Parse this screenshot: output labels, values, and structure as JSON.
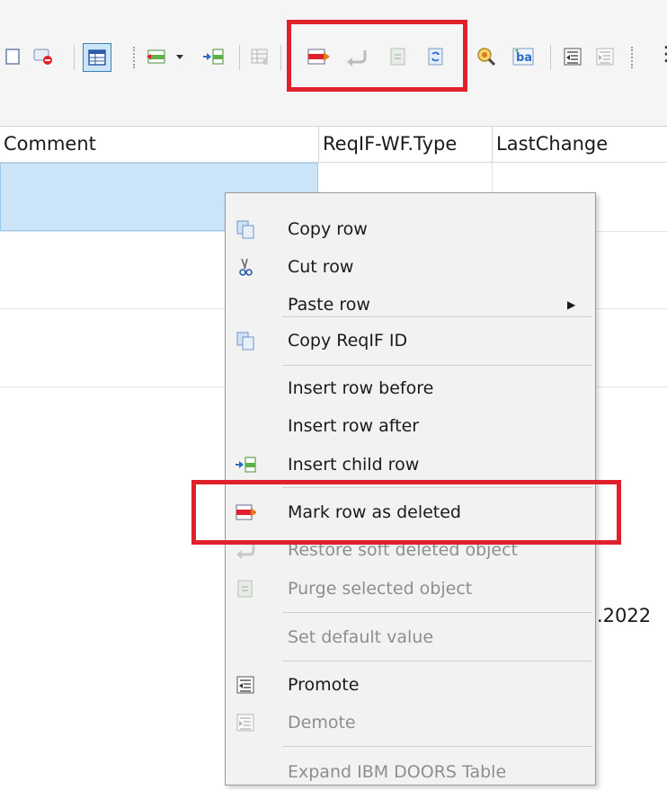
{
  "toolbar": {
    "icons": [
      "frame-icon",
      "comment-delete-icon",
      "table-view-icon",
      "insert-row-icon",
      "dropdown-arrow-icon",
      "insert-child-icon",
      "table-grid-icon",
      "mark-deleted-icon",
      "restore-icon",
      "purge-icon",
      "refresh-icon",
      "find-icon",
      "replace-icon",
      "promote-icon",
      "demote-icon"
    ],
    "overflow_label": "⋮"
  },
  "table": {
    "columns": [
      {
        "label": "Comment"
      },
      {
        "label": "ReqIF-WF.Type"
      },
      {
        "label": "LastChange"
      }
    ],
    "partial_date": ".2022"
  },
  "context_menu": {
    "items": [
      {
        "label": "Copy row",
        "icon": "copy-icon",
        "enabled": true
      },
      {
        "label": "Cut row",
        "icon": "scissors-icon",
        "enabled": true
      },
      {
        "label": "Paste row",
        "icon": "",
        "enabled": true,
        "submenu": true
      },
      {
        "label": "Copy ReqIF ID",
        "icon": "copy-icon",
        "enabled": true
      },
      {
        "label": "Insert row before",
        "icon": "",
        "enabled": true
      },
      {
        "label": "Insert row after",
        "icon": "",
        "enabled": true
      },
      {
        "label": "Insert child row",
        "icon": "insert-child-icon",
        "enabled": true
      },
      {
        "label": "Mark row as deleted",
        "icon": "mark-deleted-icon",
        "enabled": true
      },
      {
        "label": "Restore soft deleted object",
        "icon": "restore-icon",
        "enabled": false
      },
      {
        "label": "Purge selected object",
        "icon": "purge-icon",
        "enabled": false
      },
      {
        "label": "Set default value",
        "icon": "",
        "enabled": false
      },
      {
        "label": "Promote",
        "icon": "promote-icon",
        "enabled": true
      },
      {
        "label": "Demote",
        "icon": "demote-icon",
        "enabled": false
      },
      {
        "label": "Expand IBM DOORS Table",
        "icon": "",
        "enabled": false
      }
    ]
  },
  "colors": {
    "highlight": "#e0202a",
    "selection": "#cce4f7",
    "menu_background": "#f2f2f2"
  }
}
